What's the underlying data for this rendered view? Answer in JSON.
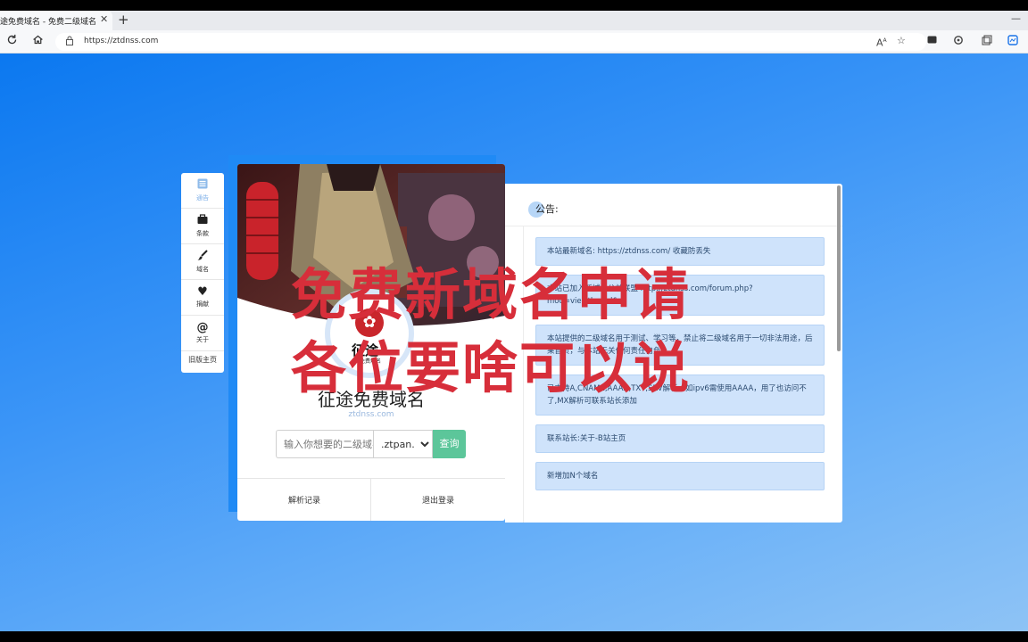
{
  "browser": {
    "tab_title": "途免费域名 - 免费二级域名",
    "close_glyph": "✕",
    "new_tab_glyph": "+",
    "minimize_glyph": "—",
    "url": "https://ztdnss.com",
    "icons": [
      "refresh-icon",
      "home-icon",
      "lock-icon",
      "read-aloud-icon",
      "favorite-icon",
      "extension-icon",
      "settings-icon",
      "collections-icon",
      "edge-icon"
    ]
  },
  "sidenav": {
    "items": [
      {
        "label": "通告",
        "icon": "list-icon",
        "active": true
      },
      {
        "label": "条款",
        "icon": "briefcase-icon"
      },
      {
        "label": "域名",
        "icon": "brush-icon"
      },
      {
        "label": "捐献",
        "icon": "heart-icon"
      },
      {
        "label": "关于",
        "icon": "at-icon"
      }
    ],
    "old_home": "旧版主页"
  },
  "card": {
    "logo_text": "征途",
    "logo_sub": "免费域名",
    "title": "征途免费域名",
    "domain": "ztdnss.com",
    "input_placeholder": "输入你想要的二级域名",
    "suffix_selected": ".ztpan.top",
    "query_label": "查询",
    "link_records": "解析记录",
    "link_logout": "退出登录"
  },
  "notice": {
    "title": "公告:",
    "items": [
      "本站最新域名: https://ztdnss.com/ 收藏防丢失",
      "本站已加入新域名公益联盟 http://ztdnss.com/forum.php?mod=viewthread&",
      "本站提供的二级域名用于测试、学习等，禁止将二级域名用于一切非法用途，后果自负，与本站无关任何责任自负！",
      "已支持A,CNAME,AAAA,TXT,SRV解析，如ipv6需使用AAAA，用了也访问不了,MX解析可联系站长添加",
      "联系站长:关于-B站主页",
      "新增加N个域名"
    ]
  },
  "watermark": {
    "line1": "免费新域名申请",
    "line2": "各位要啥可以说",
    "color": "#d72e3a"
  }
}
